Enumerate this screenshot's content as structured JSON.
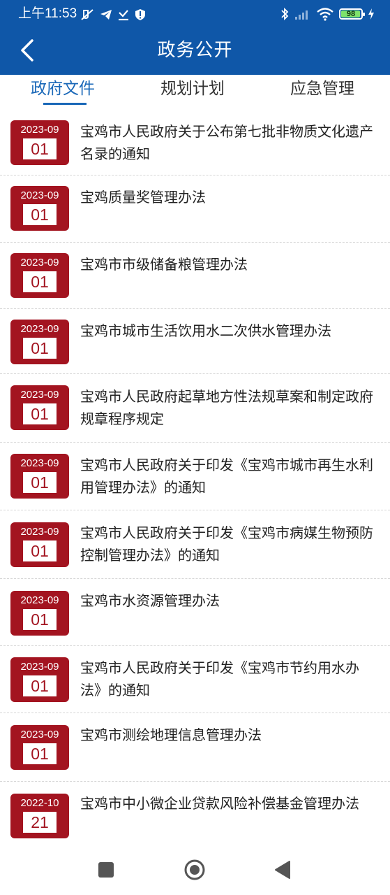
{
  "status_bar": {
    "time": "上午11:53",
    "battery": "98"
  },
  "header": {
    "title": "政务公开"
  },
  "tabs": [
    {
      "label": "政府文件",
      "active": true
    },
    {
      "label": "规划计划",
      "active": false
    },
    {
      "label": "应急管理",
      "active": false
    }
  ],
  "items": [
    {
      "ym": "2023-09",
      "day": "01",
      "title": "宝鸡市人民政府关于公布第七批非物质文化遗产名录的通知"
    },
    {
      "ym": "2023-09",
      "day": "01",
      "title": "宝鸡质量奖管理办法"
    },
    {
      "ym": "2023-09",
      "day": "01",
      "title": "宝鸡市市级储备粮管理办法"
    },
    {
      "ym": "2023-09",
      "day": "01",
      "title": "宝鸡市城市生活饮用水二次供水管理办法"
    },
    {
      "ym": "2023-09",
      "day": "01",
      "title": "宝鸡市人民政府起草地方性法规草案和制定政府规章程序规定"
    },
    {
      "ym": "2023-09",
      "day": "01",
      "title": "宝鸡市人民政府关于印发《宝鸡市城市再生水利用管理办法》的通知"
    },
    {
      "ym": "2023-09",
      "day": "01",
      "title": "宝鸡市人民政府关于印发《宝鸡市病媒生物预防控制管理办法》的通知"
    },
    {
      "ym": "2023-09",
      "day": "01",
      "title": "宝鸡市水资源管理办法"
    },
    {
      "ym": "2023-09",
      "day": "01",
      "title": "宝鸡市人民政府关于印发《宝鸡市节约用水办法》的通知"
    },
    {
      "ym": "2023-09",
      "day": "01",
      "title": "宝鸡市测绘地理信息管理办法"
    },
    {
      "ym": "2022-10",
      "day": "21",
      "title": "宝鸡市中小微企业贷款风险补偿基金管理办法"
    }
  ],
  "colors": {
    "header_bg": "#0f57a8",
    "accent": "#1a68b8",
    "date_badge": "#a31420"
  },
  "icons": {
    "back": "chevron-left-icon",
    "nav_recent": "square-icon",
    "nav_home": "circle-icon",
    "nav_back": "triangle-left-icon"
  }
}
